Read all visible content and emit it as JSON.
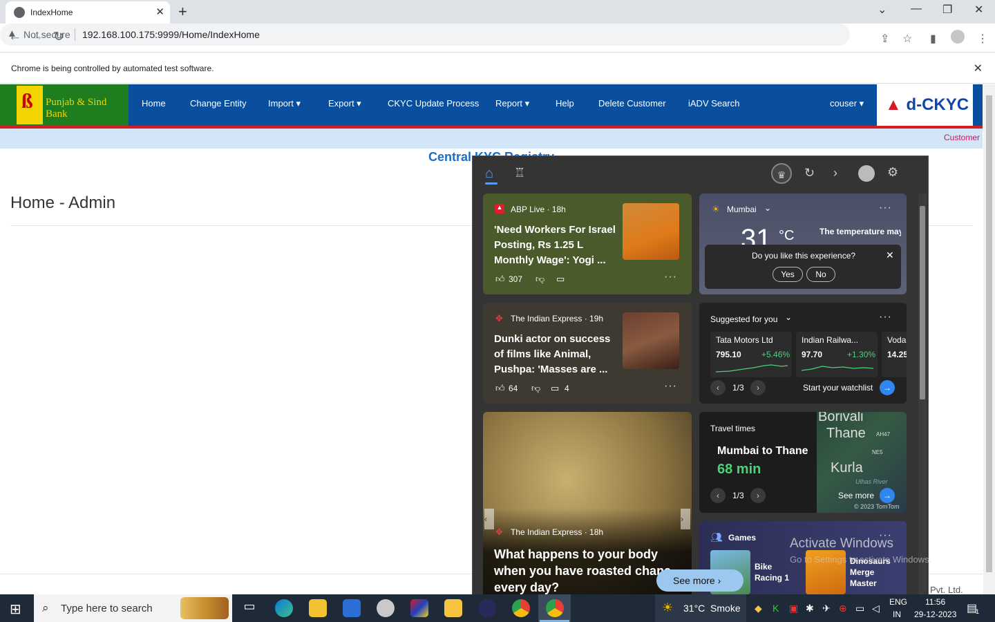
{
  "browser": {
    "tab_title": "IndexHome",
    "not_secure": "Not secure",
    "url": "192.168.100.175:9999/Home/IndexHome",
    "infobar": "Chrome is being controlled by automated test software."
  },
  "site": {
    "bank_name": "Punjab & Sind Bank",
    "nav": [
      "Home",
      "Change Entity",
      "Import ▾",
      "Export ▾",
      "CKYC Update Process",
      "Report ▾",
      "Help",
      "Delete Customer",
      "iADV Search"
    ],
    "user": "couser ▾",
    "brand": "d-CKYC",
    "customer_link": "Customer",
    "central_heading": "Central KYC Registry",
    "page_heading": "Home - Admin",
    "footer": "Pvt. Ltd."
  },
  "widgets": {
    "news1": {
      "source": "ABP Live · 18h",
      "headline": "'Need Workers For Israel Posting, Rs 1.25 L Monthly Wage': Yogi ...",
      "likes": "307"
    },
    "news2": {
      "source": "The Indian Express · 19h",
      "headline": "Dunki actor on success of films like Animal, Pushpa: 'Masses are ...",
      "likes": "64",
      "comments": "4"
    },
    "news3": {
      "source": "The Indian Express · 18h",
      "headline": "What happens to your body when you have roasted chana every day?"
    },
    "see_more_btn": "See more",
    "weather": {
      "city": "Mumbai",
      "temp": "31",
      "unit": "°C",
      "note": "The temperature may be near the",
      "feedback_q": "Do you like this experience?",
      "yes": "Yes",
      "no": "No"
    },
    "stocks": {
      "header": "Suggested for you",
      "items": [
        {
          "name": "Tata Motors Ltd",
          "price": "795.10",
          "change": "+5.46%"
        },
        {
          "name": "Indian Railwa...",
          "price": "97.70",
          "change": "+1.30%"
        },
        {
          "name": "Voda",
          "price": "14.25",
          "change": ""
        }
      ],
      "pager": "1/3",
      "watchlist": "Start your watchlist"
    },
    "travel": {
      "header": "Travel times",
      "route": "Mumbai to Thane",
      "time": "68 min",
      "pager": "1/3",
      "see_more": "See more",
      "map_labels": [
        "Borivali",
        "Thane",
        "Kurla",
        "AH47",
        "NE5",
        "Ulhas River"
      ],
      "copyright": "© 2023 TomTom"
    },
    "games": {
      "header": "Games",
      "items": [
        "Bike Racing 1",
        "Dinosaurs Merge Master"
      ]
    },
    "activate": "Activate Windows",
    "activate_sub": "Go to Settings to activate Windows."
  },
  "taskbar": {
    "search_placeholder": "Type here to search",
    "weather": "31°C  Smoke",
    "lang1": "ENG",
    "lang2": "IN",
    "time": "11:56",
    "date": "29-12-2023",
    "notif": "1"
  }
}
